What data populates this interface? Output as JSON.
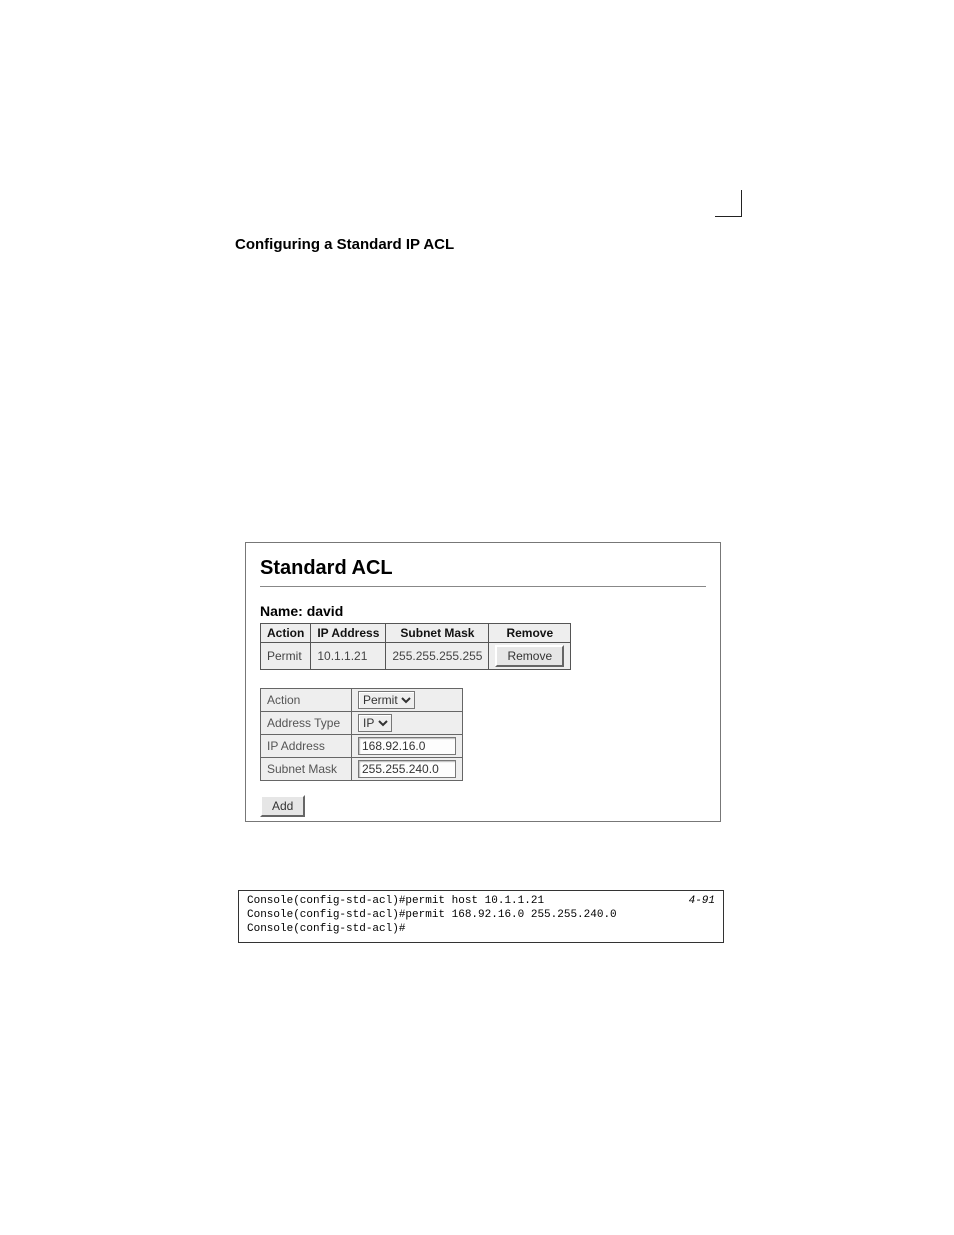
{
  "section_title": "Configuring a Standard IP ACL",
  "panel": {
    "title": "Standard ACL",
    "name_label": "Name: ",
    "name_value": "david",
    "headers": {
      "action": "Action",
      "ip": "IP Address",
      "mask": "Subnet Mask",
      "remove": "Remove"
    },
    "row": {
      "action": "Permit",
      "ip": "10.1.1.21",
      "mask": "255.255.255.255"
    },
    "remove_btn": "Remove",
    "form": {
      "action_label": "Action",
      "action_value": "Permit",
      "addrtype_label": "Address Type",
      "addrtype_value": "IP",
      "ip_label": "IP Address",
      "ip_value": "168.92.16.0",
      "mask_label": "Subnet Mask",
      "mask_value": "255.255.240.0"
    },
    "add_btn": "Add"
  },
  "cli": {
    "ref": "4-91",
    "line1": "Console(config-std-acl)#permit host 10.1.1.21",
    "line2": "Console(config-std-acl)#permit 168.92.16.0 255.255.240.0",
    "line3": "Console(config-std-acl)#"
  }
}
